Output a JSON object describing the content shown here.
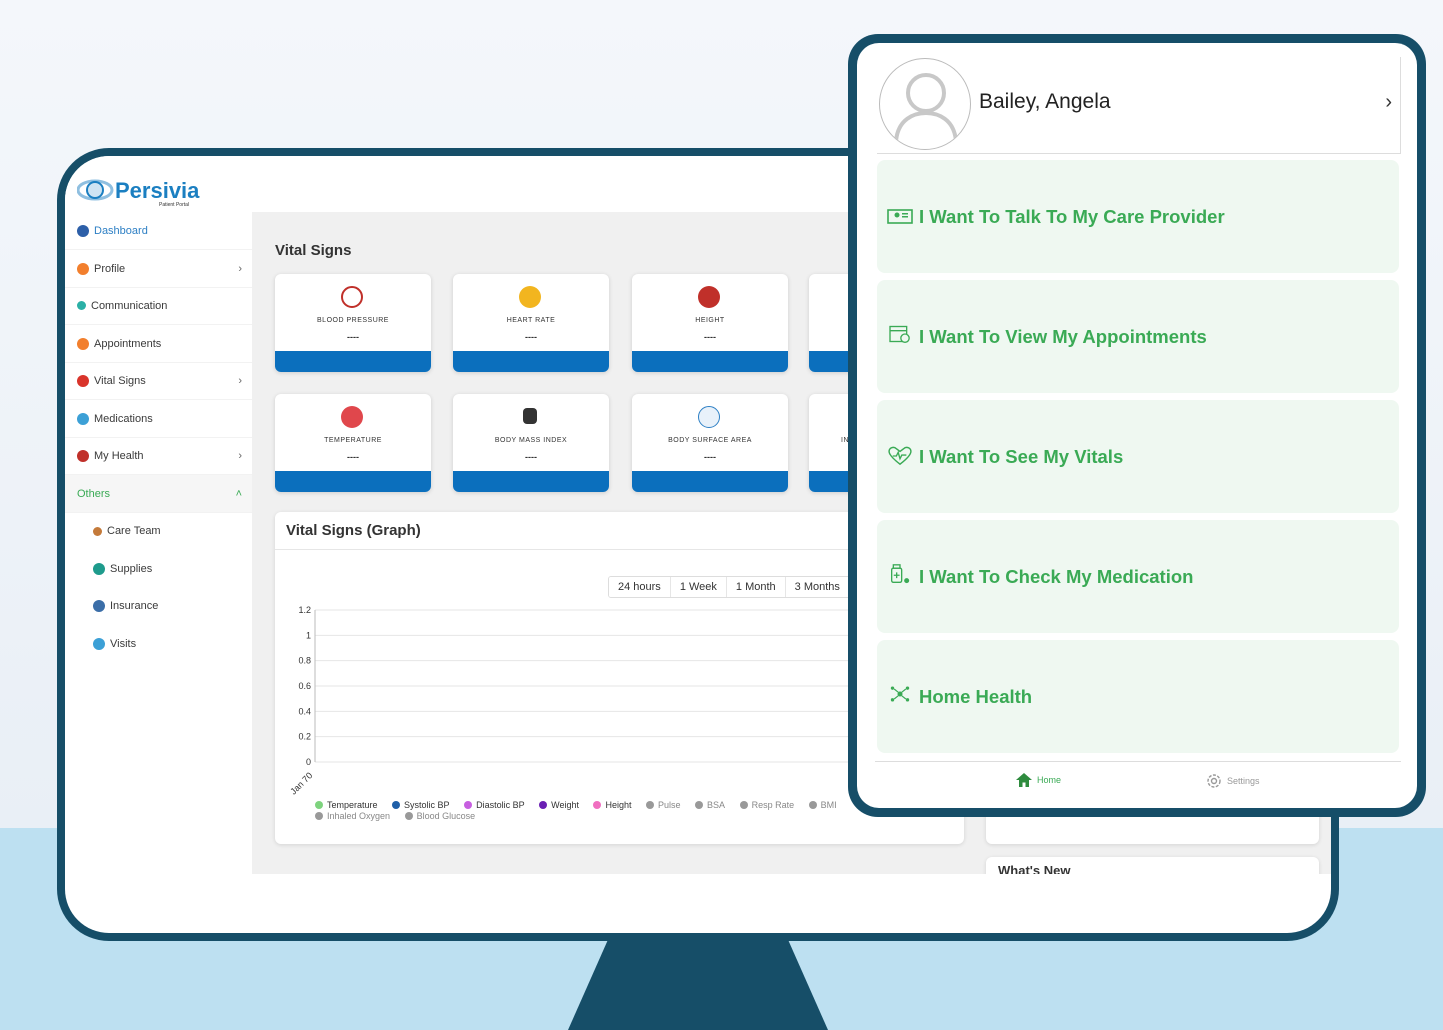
{
  "brand": {
    "name": "Persivia",
    "tagline": "Patient Portal"
  },
  "sidebar": {
    "items": [
      {
        "label": "Dashboard",
        "icon": "home-icon",
        "color": "#2d5fa8",
        "active": true,
        "chevron": ""
      },
      {
        "label": "Profile",
        "icon": "user-icon",
        "color": "#f27f2d",
        "chevron": "›"
      },
      {
        "label": "Communication",
        "icon": "phone-icon",
        "color": "#2bb0a6",
        "chevron": ""
      },
      {
        "label": "Appointments",
        "icon": "calendar-icon",
        "color": "#f27f2d",
        "chevron": ""
      },
      {
        "label": "Vital Signs",
        "icon": "vitals-icon",
        "color": "#d9342b",
        "chevron": "›"
      },
      {
        "label": "Medications",
        "icon": "pill-icon",
        "color": "#3ca0d6",
        "chevron": ""
      },
      {
        "label": "My Health",
        "icon": "health-icon",
        "color": "#c0302a",
        "chevron": "›"
      },
      {
        "label": "Others",
        "icon": "",
        "color": "#3aaa55",
        "chevron": "˄"
      }
    ],
    "subitems": [
      {
        "label": "Care Team",
        "icon": "team-icon",
        "color": "#c47a3a"
      },
      {
        "label": "Supplies",
        "icon": "supplies-icon",
        "color": "#1e9b8c"
      },
      {
        "label": "Insurance",
        "icon": "insurance-icon",
        "color": "#3b6ea8"
      },
      {
        "label": "Visits",
        "icon": "visits-icon",
        "color": "#3ca0d6"
      }
    ]
  },
  "vitals": {
    "title": "Vital Signs",
    "cards": [
      {
        "label": "BLOOD PRESSURE",
        "value": "----",
        "icon": "blood-pressure-icon",
        "color": "#c0302a"
      },
      {
        "label": "HEART RATE",
        "value": "----",
        "icon": "heart-rate-icon",
        "color": "#f2b51f"
      },
      {
        "label": "HEIGHT",
        "value": "----",
        "icon": "height-icon",
        "color": "#c0302a"
      },
      {
        "label": "TEMPERATURE",
        "value": "----",
        "icon": "thermometer-icon",
        "color": "#e0474c"
      },
      {
        "label": "BODY MASS INDEX",
        "value": "----",
        "icon": "scale-icon",
        "color": "#333333"
      },
      {
        "label": "BODY SURFACE AREA",
        "value": "----",
        "icon": "body-surface-icon",
        "color": "#2d7fc4"
      }
    ],
    "partial_label": "IN"
  },
  "graph": {
    "title": "Vital Signs (Graph)",
    "tabs": [
      "24 hours",
      "1 Week",
      "1 Month",
      "3 Months"
    ],
    "legend": [
      {
        "name": "Temperature",
        "color": "#7ed37e"
      },
      {
        "name": "Systolic BP",
        "color": "#1f5fa8"
      },
      {
        "name": "Diastolic BP",
        "color": "#c75fe0"
      },
      {
        "name": "Weight",
        "color": "#6a1fb3"
      },
      {
        "name": "Height",
        "color": "#f06fc0"
      },
      {
        "name": "Pulse",
        "color": "#999999"
      },
      {
        "name": "BSA",
        "color": "#999999"
      },
      {
        "name": "Resp Rate",
        "color": "#999999"
      },
      {
        "name": "BMI",
        "color": "#999999"
      },
      {
        "name": "Inhaled Oxygen",
        "color": "#999999"
      },
      {
        "name": "Blood Glucose",
        "color": "#999999"
      }
    ]
  },
  "chart_data": {
    "type": "line",
    "x": [
      "Jan 70"
    ],
    "ylim": [
      0,
      1.2
    ],
    "yticks": [
      "0",
      "0.2",
      "0.4",
      "0.6",
      "0.8",
      "1",
      "1.2"
    ],
    "grid": true,
    "legend_position": "bottom",
    "series": []
  },
  "right_panel": {
    "whats_new": "What's New"
  },
  "mobile": {
    "patient_name": "Bailey, Angela",
    "chevron": "›",
    "menu": [
      {
        "label": "I Want To Talk To My Care Provider",
        "icon": "provider-icon"
      },
      {
        "label": "I Want To View My Appointments",
        "icon": "appointment-icon"
      },
      {
        "label": "I Want To See My Vitals",
        "icon": "heartbeat-icon"
      },
      {
        "label": "I Want To Check My Medication",
        "icon": "medication-icon"
      },
      {
        "label": "Home Health",
        "icon": "home-health-icon"
      }
    ],
    "nav": [
      {
        "label": "Home",
        "icon": "home-icon",
        "color": "#3aaa55"
      },
      {
        "label": "Settings",
        "icon": "gear-icon",
        "color": "#999999"
      }
    ],
    "accent": "#3aaa55"
  }
}
